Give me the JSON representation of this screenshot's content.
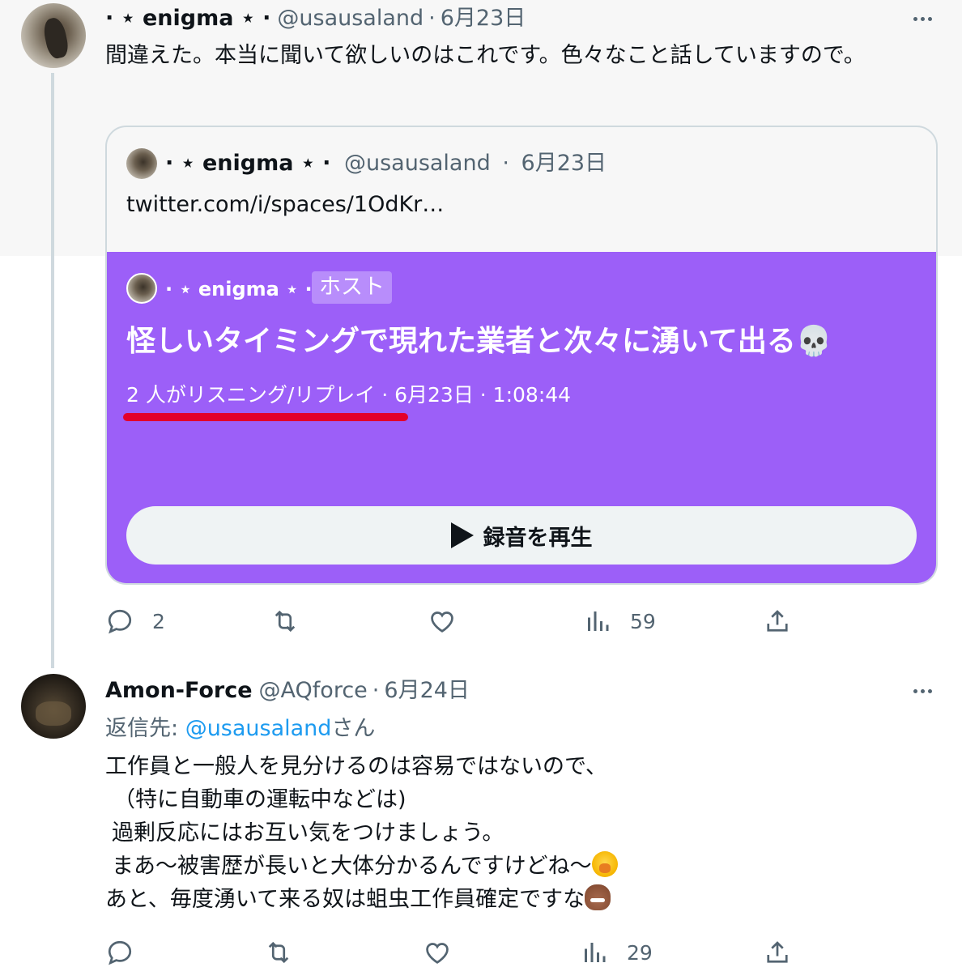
{
  "tweet1": {
    "name": "⋅ ⋆ enigma ⋆ ⋅",
    "handle": "@usausaland",
    "separator": "·",
    "date": "6月23日",
    "text": "間違えた。本当に聞いて欲しいのはこれです。色々なこと話していますので。",
    "quote": {
      "name": "⋅ ⋆ enigma ⋆ ⋅",
      "handle": "@usausaland",
      "date": "6月23日",
      "link_text": "twitter.com/i/spaces/1OdKr…",
      "space": {
        "host_name": "⋅ ⋆ enigma ⋆ ⋅",
        "host_badge": "ホスト",
        "title": "怪しいタイミングで現れた業者と次々に湧いて出る💀",
        "listeners": "2 人がリスニング/リプレイ",
        "meta_rest": " · 6月23日 · 1:08:44",
        "play_label": "録音を再生"
      }
    },
    "actions": {
      "replies": "2",
      "retweets": "",
      "likes": "",
      "views": "59"
    }
  },
  "tweet2": {
    "name": "Amon-Force",
    "handle": "@AQforce",
    "separator": "·",
    "date": "6月24日",
    "reply_prefix": "返信先: ",
    "reply_mention": "@usausaland",
    "reply_suffix": "さん",
    "lines": [
      "工作員と一般人を見分けるのは容易ではないので、",
      "（特に自動車の運転中などは)",
      "過剰反応にはお互い気をつけましょう。",
      "まあ～被害歴が長いと大体分かるんですけどね～",
      "あと、毎度湧いて来る奴は蛆虫工作員確定ですな"
    ],
    "actions": {
      "replies": "",
      "retweets": "",
      "likes": "",
      "views": "29"
    }
  },
  "icons": {
    "reply": "reply-icon",
    "retweet": "retweet-icon",
    "like": "heart-icon",
    "views": "views-icon",
    "share": "share-icon",
    "more": "more-icon"
  },
  "colors": {
    "space_purple": "#9c5ff8",
    "link_blue": "#1d9bf0",
    "underline_red": "#e3002a"
  }
}
